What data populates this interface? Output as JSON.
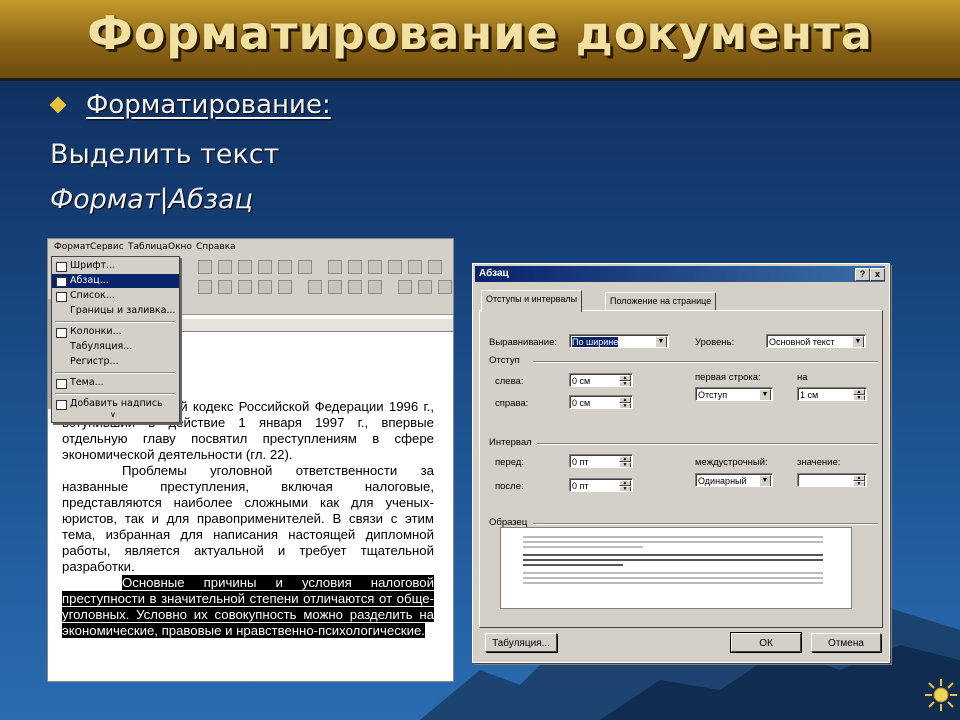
{
  "slide": {
    "title": "Форматирование документа",
    "bullet": "Форматирование:",
    "line2": "Выделить текст",
    "line3": "Формат|Абзац"
  },
  "word": {
    "menu": [
      "Формат",
      "Сервис",
      "Таблица",
      "Окно",
      "Справка"
    ],
    "format_menu": [
      {
        "label": "Шрифт...",
        "selected": false
      },
      {
        "label": "Абзац...",
        "selected": true
      },
      {
        "label": "Список...",
        "selected": false
      },
      {
        "label": "Границы и заливка...",
        "selected": false
      },
      {
        "label": "Колонки...",
        "selected": false
      },
      {
        "label": "Табуляция...",
        "selected": false
      },
      {
        "label": "Регистр...",
        "selected": false
      },
      {
        "label": "Тема...",
        "selected": false
      },
      {
        "label": "Добавить надпись",
        "selected": false
      }
    ],
    "doc_para1_visible": "Уголовный кодекс Российской Федерации 1996 г., вступивший в действие 1 января 1997 г., впервые отдельную главу посвятил преступлениям в сфере экономической деятельности (гл. 22).",
    "doc_para2": "Проблемы уголовной ответственности за названные преступления, включая налоговые, представляются наиболее сложными как для ученых-юристов, так и для правоприменителей. В связи с этим тема, избранная для написания настоящей дипломной работы, является актуальной и требует тщательной разработки.",
    "doc_para3": "Основные причины и условия налоговой преступности в значительной степени отличаются от обще-уголовных. Условно их совокупность можно разделить на экономические, правовые и нравственно-психологические."
  },
  "dialog": {
    "title": "Абзац",
    "help_button": "?",
    "close_button": "x",
    "tabs": [
      "Отступы и интервалы",
      "Положение на странице"
    ],
    "alignment_label": "Выравнивание:",
    "alignment_value": "По ширине",
    "level_label": "Уровень:",
    "level_value": "Основной текст",
    "indent_group": "Отступ",
    "left_label": "слева:",
    "left_value": "0 см",
    "right_label": "справа:",
    "right_value": "0 см",
    "first_line_label": "первая строка:",
    "first_line_value": "Отступ",
    "by_label": "на",
    "by_value": "1 см",
    "spacing_group": "Интервал",
    "before_label": "перед:",
    "before_value": "0 пт",
    "after_label": "после:",
    "after_value": "0 пт",
    "line_spacing_label": "междустрочный:",
    "line_spacing_value": "Одинарный",
    "value_label": "значение:",
    "value_value": "",
    "preview_group": "Образец",
    "tabs_button": "Табуляция...",
    "ok_button": "ОК",
    "cancel_button": "Отмена"
  }
}
